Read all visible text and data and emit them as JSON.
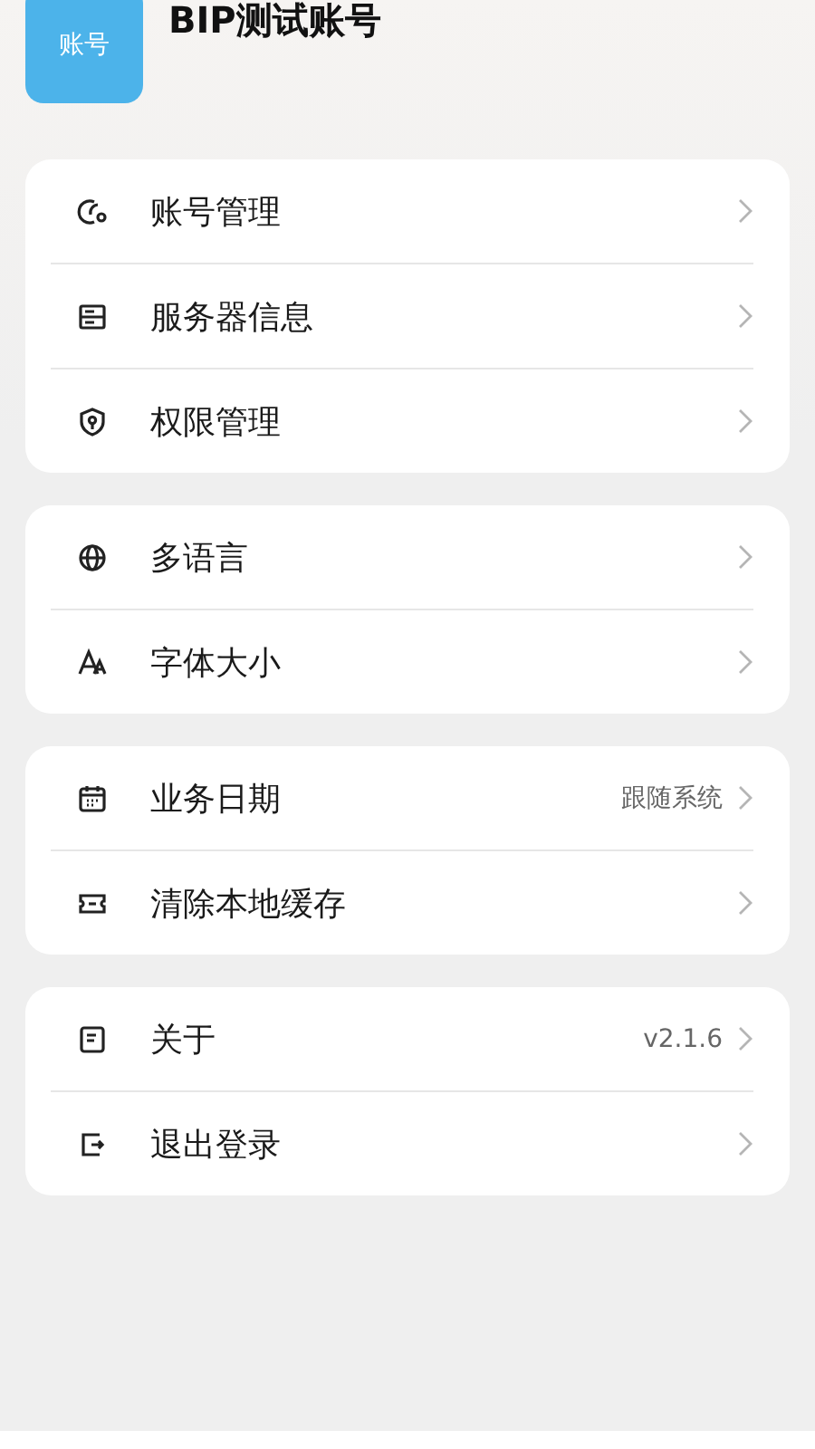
{
  "profile": {
    "avatar_text": "账号",
    "name": "BIP测试账号"
  },
  "groups": [
    {
      "items": [
        {
          "label": "账号管理"
        },
        {
          "label": "服务器信息"
        },
        {
          "label": "权限管理"
        }
      ]
    },
    {
      "items": [
        {
          "label": "多语言"
        },
        {
          "label": "字体大小"
        }
      ]
    },
    {
      "items": [
        {
          "label": "业务日期",
          "value": "跟随系统"
        },
        {
          "label": "清除本地缓存"
        }
      ]
    },
    {
      "items": [
        {
          "label": "关于",
          "value": "v2.1.6"
        },
        {
          "label": "退出登录"
        }
      ]
    }
  ]
}
